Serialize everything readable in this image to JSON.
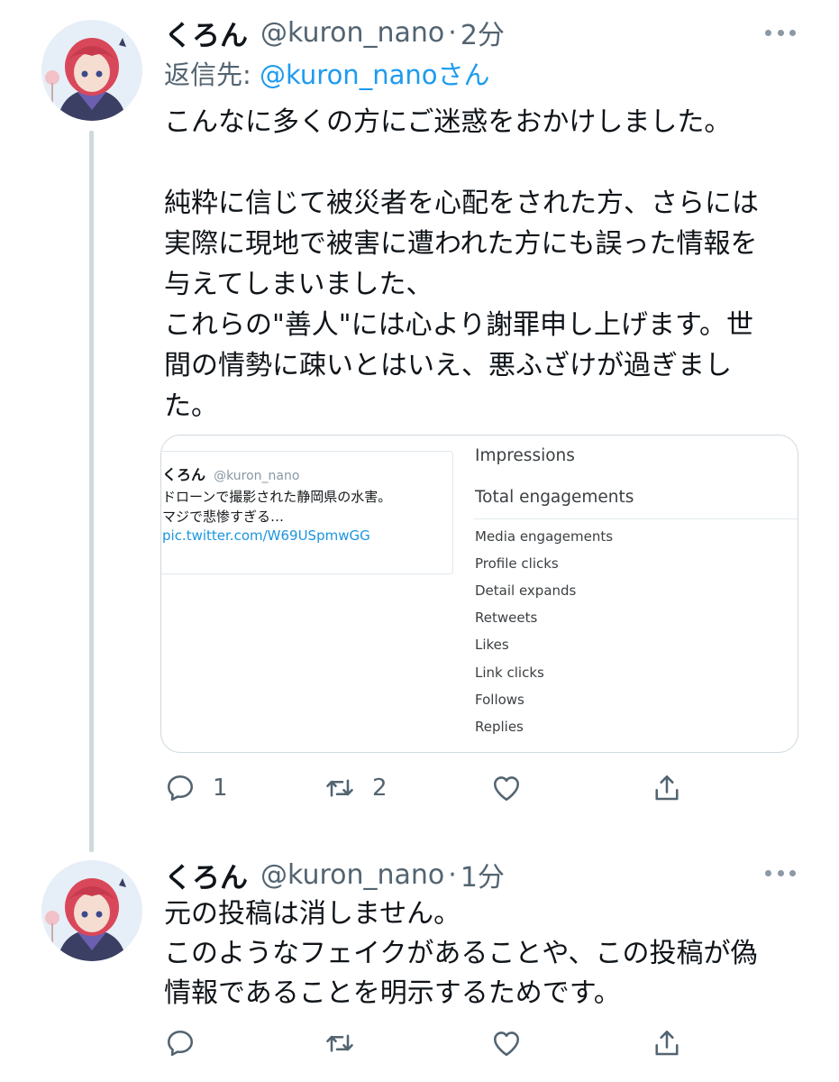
{
  "tweets": [
    {
      "display_name": "くろん",
      "handle": "@kuron_nano",
      "separator": "·",
      "time": "2分",
      "reply_to": {
        "prefix": "返信先: ",
        "mention": "@kuron_nano",
        "suffix": "さん"
      },
      "text_lines": [
        "こんなに多くの方にご迷惑をおかけしました。",
        "",
        "純粋に信じて被災者を心配をされた方、さらには",
        "実際に現地で被害に遭われた方にも誤った情報を",
        "与えてしまいました、",
        "これらの\"善人\"には心より謝罪申し上げます。世",
        "間の情勢に疎いとはいえ、悪ふざけが過ぎまし",
        "た。"
      ],
      "media": {
        "embed": {
          "name": "くろん",
          "handle": "@kuron_nano",
          "lines": [
            "ドローンで撮影された静岡県の水害。",
            "マジで悲惨すぎる…"
          ],
          "link": "pic.twitter.com/W69USpmwGG"
        },
        "metrics": {
          "impressions_label": "Impressions",
          "engagements_label": "Total engagements",
          "items": [
            "Media engagements",
            "Profile clicks",
            "Detail expands",
            "Retweets",
            "Likes",
            "Link clicks",
            "Follows",
            "Replies"
          ]
        }
      },
      "actions": {
        "reply_count": "1",
        "retweet_count": "2",
        "like_count": ""
      }
    },
    {
      "display_name": "くろん",
      "handle": "@kuron_nano",
      "separator": "·",
      "time": "1分",
      "text_lines": [
        "元の投稿は消しません。",
        "このようなフェイクがあることや、この投稿が偽",
        "情報であることを明示するためです。"
      ],
      "actions": {
        "reply_count": "",
        "retweet_count": "",
        "like_count": ""
      }
    }
  ],
  "icons": {
    "reply": "reply-bubble-icon",
    "retweet": "retweet-arrows-icon",
    "like": "heart-icon",
    "share": "share-upload-icon",
    "more": "more-dots-icon"
  },
  "colors": {
    "text": "#0f1419",
    "secondary": "#536471",
    "accent": "#1d9bf0",
    "border": "#cfd9de",
    "thread_line": "#cfd9de"
  }
}
